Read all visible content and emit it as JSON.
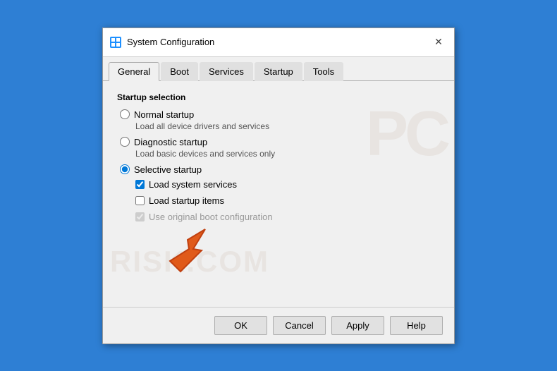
{
  "titleBar": {
    "title": "System Configuration",
    "closeLabel": "✕"
  },
  "tabs": {
    "items": [
      "General",
      "Boot",
      "Services",
      "Startup",
      "Tools"
    ],
    "activeIndex": 0
  },
  "content": {
    "groupLabel": "Startup selection",
    "radioOptions": [
      {
        "id": "normal",
        "label": "Normal startup",
        "sublabel": "Load all device drivers and services",
        "checked": false
      },
      {
        "id": "diagnostic",
        "label": "Diagnostic startup",
        "sublabel": "Load basic devices and services only",
        "checked": false
      },
      {
        "id": "selective",
        "label": "Selective startup",
        "sublabel": "",
        "checked": true
      }
    ],
    "checkboxes": [
      {
        "id": "load-system",
        "label": "Load system services",
        "checked": true,
        "disabled": false
      },
      {
        "id": "load-startup",
        "label": "Load startup items",
        "checked": false,
        "disabled": false
      },
      {
        "id": "use-original",
        "label": "Use original boot configuration",
        "checked": true,
        "disabled": true
      }
    ]
  },
  "footer": {
    "ok": "OK",
    "cancel": "Cancel",
    "apply": "Apply",
    "help": "Help"
  },
  "watermark": {
    "line1": "PC",
    "line2": "RISK.COM"
  }
}
